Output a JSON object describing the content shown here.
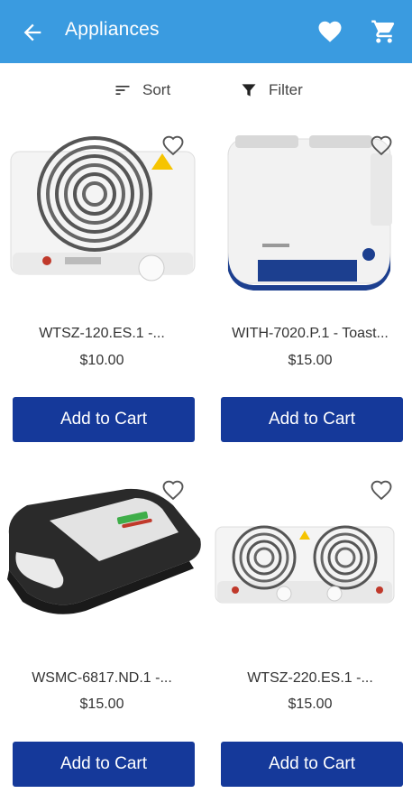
{
  "header": {
    "title": "Appliances"
  },
  "toolbar": {
    "sort_label": "Sort",
    "filter_label": "Filter"
  },
  "products": [
    {
      "name": "WTSZ-120.ES.1 -...",
      "price": "$10.00",
      "button": "Add to Cart"
    },
    {
      "name": "WITH-7020.P.1 - Toast...",
      "price": "$15.00",
      "button": "Add to Cart"
    },
    {
      "name": "WSMC-6817.ND.1 -...",
      "price": "$15.00",
      "button": "Add to Cart"
    },
    {
      "name": "WTSZ-220.ES.1 -...",
      "price": "$15.00",
      "button": "Add to Cart"
    }
  ],
  "colors": {
    "appbar": "#3a9be0",
    "button": "#15399a"
  }
}
